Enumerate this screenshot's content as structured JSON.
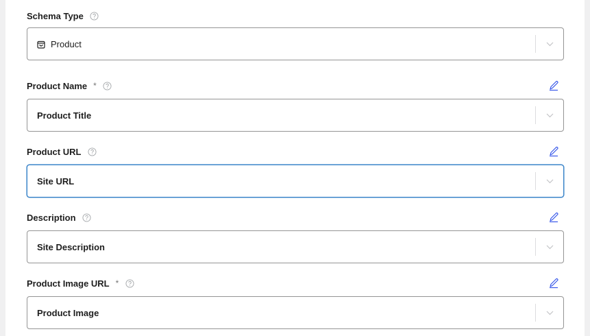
{
  "fields": [
    {
      "label": "Schema Type",
      "required": false,
      "help_icon": "question-circle-icon",
      "editable": false,
      "value": "Product",
      "value_icon": "shopping-bag-icon",
      "focused": false
    },
    {
      "label": "Product Name",
      "required": true,
      "required_mark": "*",
      "help_icon": "question-circle-icon",
      "editable": true,
      "edit_icon": "pencil-icon",
      "value": "Product Title",
      "focused": false
    },
    {
      "label": "Product URL",
      "required": false,
      "help_icon": "question-circle-icon",
      "editable": true,
      "edit_icon": "pencil-icon",
      "value": "Site URL",
      "focused": true
    },
    {
      "label": "Description",
      "required": false,
      "help_icon": "question-circle-icon",
      "editable": true,
      "edit_icon": "pencil-icon",
      "value": "Site Description",
      "focused": false
    },
    {
      "label": "Product Image URL",
      "required": true,
      "required_mark": "*",
      "help_icon": "question-circle-icon",
      "editable": true,
      "edit_icon": "pencil-icon",
      "value": "Product Image",
      "focused": false
    }
  ],
  "colors": {
    "border": "#949494",
    "focus_border": "#3a84c9",
    "edit_icon": "#3858e9",
    "muted_icon": "#a7aaad",
    "background": "#f0f0f1"
  }
}
